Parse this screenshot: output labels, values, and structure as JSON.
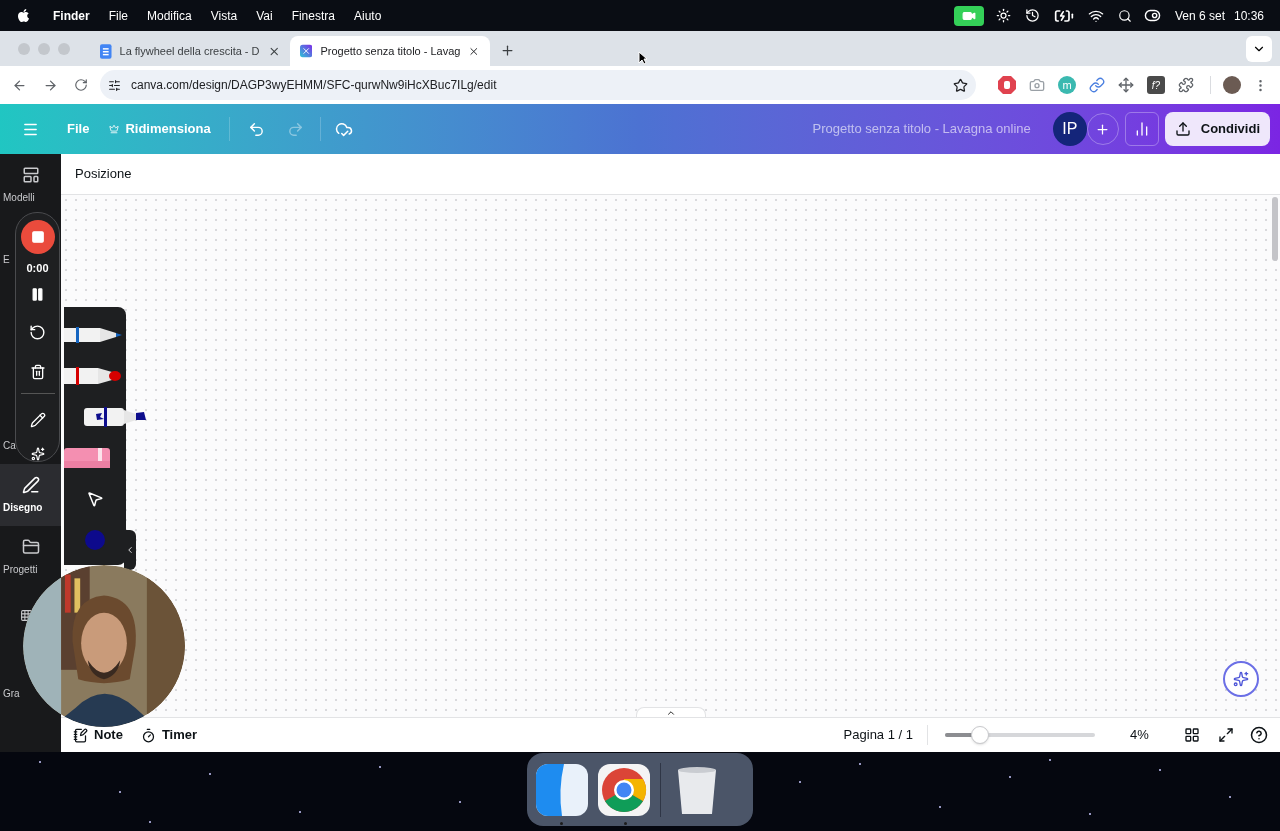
{
  "menubar": {
    "app": "Finder",
    "menus": [
      "File",
      "Modifica",
      "Vista",
      "Vai",
      "Finestra",
      "Aiuto"
    ],
    "date": "Ven 6 set",
    "time": "10:36"
  },
  "browser": {
    "tabs": [
      {
        "title": "La flywheel della crescita - D",
        "kind": "docs",
        "selected": false
      },
      {
        "title": "Progetto senza titolo - Lavag",
        "kind": "canva",
        "selected": true
      }
    ],
    "url": "canva.com/design/DAGP3wyEHMM/SFC-qurwNw9iHcXBuc7ILg/edit",
    "extensions": [
      {
        "kind": "stop"
      },
      {
        "kind": "camera"
      },
      {
        "kind": "letter",
        "text": "m"
      },
      {
        "kind": "link"
      },
      {
        "kind": "move"
      },
      {
        "kind": "letter-dark",
        "text": "f?"
      },
      {
        "kind": "puzzle"
      }
    ]
  },
  "toolbar": {
    "file": "File",
    "resize": "Ridimensiona",
    "redo_disabled": true,
    "title": "Progetto senza titolo - Lavagna online",
    "avatar": "IP",
    "share": "Condividi"
  },
  "sidebar": {
    "top_items": [
      {
        "label": "Modelli",
        "kind": "templates",
        "selected": false
      },
      {
        "label": "E",
        "selected": false
      }
    ],
    "items": [
      {
        "label": "Ca",
        "selected": false
      },
      {
        "label": "Disegno",
        "kind": "draw",
        "selected": true
      },
      {
        "label": "Progetti",
        "kind": "projects",
        "selected": false
      },
      {
        "kind": "apps",
        "selected": false
      },
      {
        "label": "Gra",
        "selected": false
      }
    ]
  },
  "recorder": {
    "time": "0:00"
  },
  "pen_tools": {
    "tools": [
      {
        "kind": "pen",
        "color": "#1565c0",
        "selected": false
      },
      {
        "kind": "marker",
        "color": "#d50000",
        "selected": false
      },
      {
        "kind": "highlighter",
        "color": "#0d0d8c",
        "selected": true
      },
      {
        "kind": "eraser",
        "selected": false
      },
      {
        "kind": "pointer",
        "selected": false
      },
      {
        "kind": "swatch",
        "color": "#0d0a8c",
        "selected": false
      }
    ]
  },
  "canvas": {
    "header": "Posizione"
  },
  "footer": {
    "notes": "Note",
    "timer": "Timer",
    "page": "Pagina 1 / 1",
    "zoom": {
      "level": 0.23
    },
    "zoom_reading": "4%"
  }
}
